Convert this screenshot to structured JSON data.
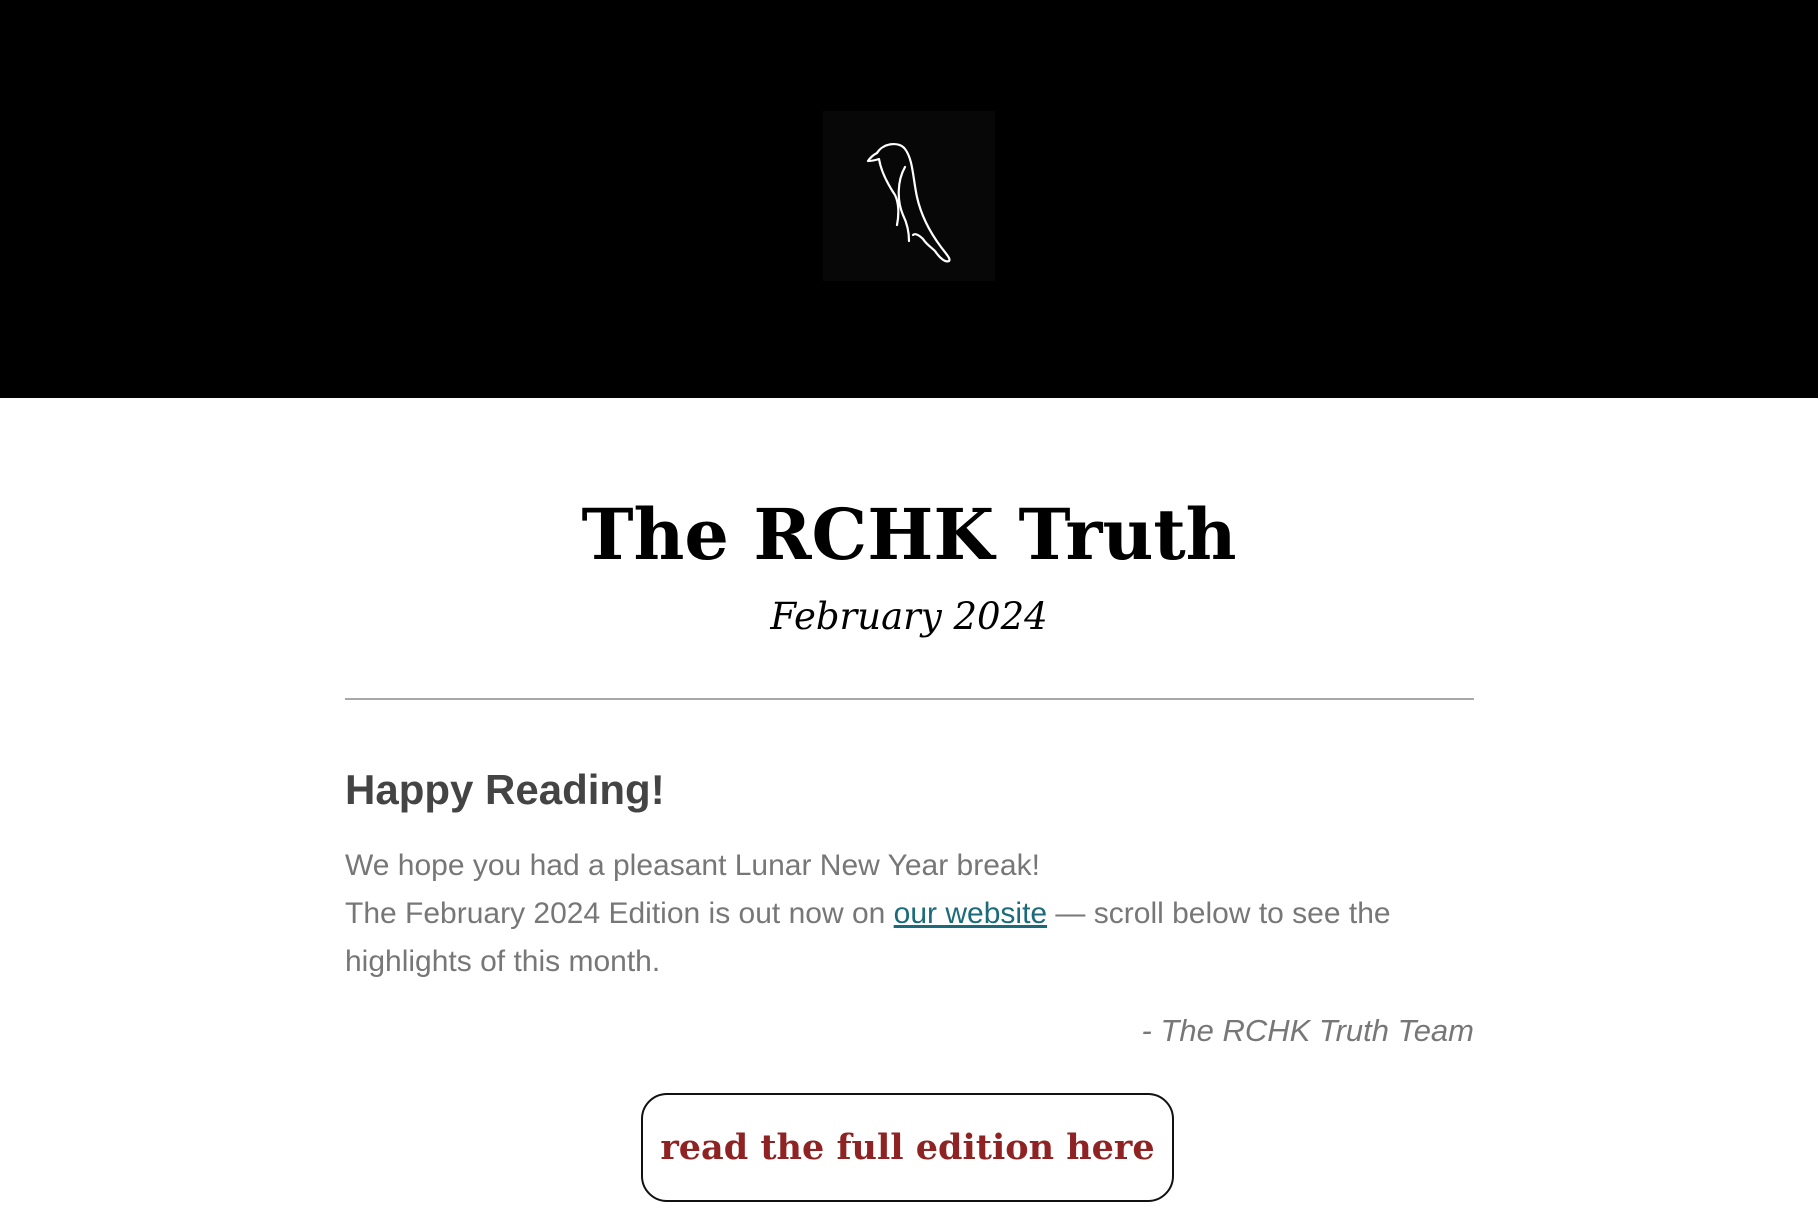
{
  "header": {
    "background_color": "#000000",
    "logo_icon": "bird-outline-icon"
  },
  "masthead": {
    "title": "The RCHK Truth",
    "edition_date": "February 2024"
  },
  "intro": {
    "heading": "Happy Reading!",
    "line1": "We hope you had a pleasant Lunar New Year break!",
    "line2_before_link": "The February 2024 Edition is out now on ",
    "link_text": "our website",
    "line2_after_link": " — scroll below to see the highlights of this month.",
    "signoff": "- The RCHK Truth Team"
  },
  "cta": {
    "label": "read the full edition here",
    "text_color": "#8f2323"
  },
  "colors": {
    "link": "#1b6b7a",
    "body_text": "#777777",
    "heading": "#444444"
  }
}
